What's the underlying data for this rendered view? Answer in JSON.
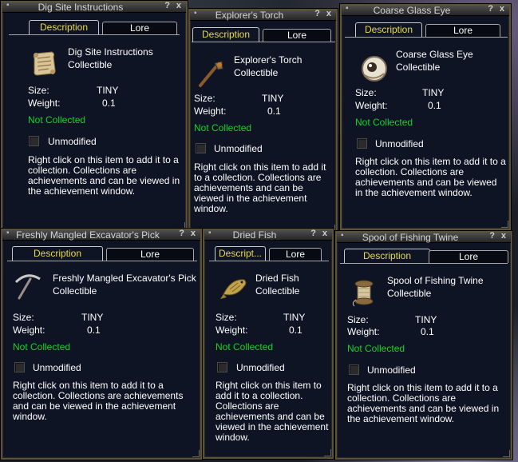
{
  "common": {
    "tab_description": "Description",
    "tab_lore": "Lore",
    "size_label": "Size:",
    "weight_label": "Weight:",
    "size_value": "TINY",
    "weight_value": "0.1",
    "item_type": "Collectible",
    "status": "Not Collected",
    "checkbox_label": "Unmodified",
    "help_glyph": "?",
    "close_glyph": "x",
    "status_color": "#13d22a",
    "active_tab_color": "#e8d94a"
  },
  "windows": [
    {
      "title": "Dig Site Instructions",
      "name": "Dig Site Instructions",
      "tab_description": "Description",
      "description": "Right click on this item to add it to a collection. Collections are achievements and can be viewed in the achievement window.",
      "icon": "scroll-icon"
    },
    {
      "title": "Explorer's Torch",
      "name": "Explorer's Torch",
      "tab_description": "Description",
      "description": "Right click on this item to add it to a collection. Collections are achievements and can be viewed in the achievement window.",
      "icon": "torch-icon"
    },
    {
      "title": "Coarse Glass Eye",
      "name": "Coarse Glass Eye",
      "tab_description": "Description",
      "description": "Right click on this item to add it to a collection. Collections are achievements and can be viewed in the achievement window.",
      "icon": "glass-eye-icon"
    },
    {
      "title": "Freshly Mangled Excavator's Pick",
      "name": "Freshly Mangled Excavator's Pick",
      "tab_description": "Description",
      "description": "Right click on this item to add it to a collection. Collections are achievements and can be viewed in the achievement window.",
      "icon": "pickaxe-icon"
    },
    {
      "title": "Dried Fish",
      "name": "Dried Fish",
      "tab_description": "Descript...",
      "description": "Right click on this item to add it to a collection. Collections are achievements and can be viewed in the achievement window.",
      "icon": "fish-icon"
    },
    {
      "title": "Spool of Fishing Twine",
      "name": "Spool of Fishing Twine",
      "tab_description": "Description",
      "description": "Right click on this item to add it to a collection. Collections are achievements and can be viewed in the achievement window.",
      "icon": "spool-icon"
    }
  ]
}
